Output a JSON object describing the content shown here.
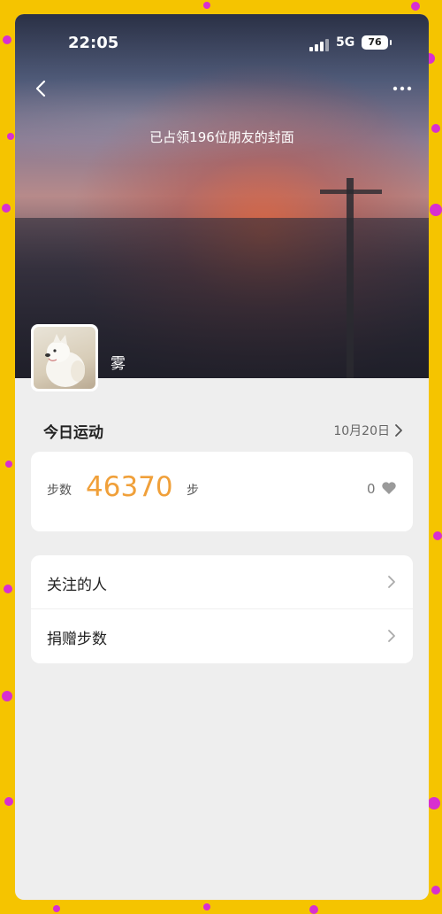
{
  "status_bar": {
    "time": "22:05",
    "network": "5G",
    "battery": "76"
  },
  "cover": {
    "caption": "已占领196位朋友的封面"
  },
  "profile": {
    "nickname": "雾"
  },
  "today": {
    "title": "今日运动",
    "date": "10月20日"
  },
  "steps": {
    "label": "步数",
    "value": "46370",
    "unit": "步",
    "likes": "0"
  },
  "menu": {
    "items": [
      {
        "label": "关注的人"
      },
      {
        "label": "捐赠步数"
      }
    ]
  },
  "colors": {
    "accent": "#f0a03a",
    "frame": "#f5c400",
    "frame_dots": "#d82fd0"
  }
}
